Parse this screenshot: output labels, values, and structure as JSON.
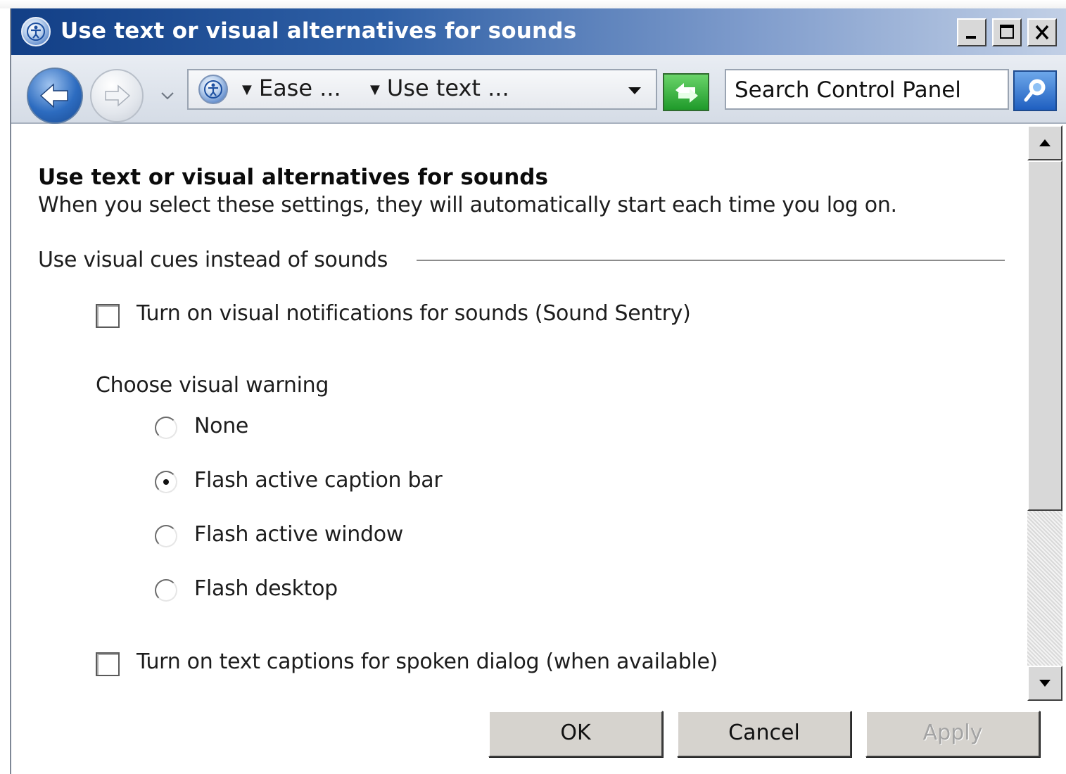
{
  "window": {
    "title": "Use text or visual alternatives for sounds"
  },
  "title_buttons": [
    "minimize",
    "maximize",
    "close"
  ],
  "address_bar": {
    "breadcrumbs": [
      {
        "label": "Ease ..."
      },
      {
        "label": "Use text ..."
      }
    ],
    "search": {
      "placeholder": "Search Control Panel",
      "value": ""
    }
  },
  "content": {
    "heading": "Use text or visual alternatives for sounds",
    "description": "When you select these settings, they will automatically start each time you log on.",
    "group_label": "Use visual cues instead of sounds",
    "sound_sentry": {
      "label": "Turn on visual notifications for sounds (Sound Sentry)",
      "checked": false
    },
    "choose_label": "Choose visual warning",
    "warnings": [
      {
        "label": "None",
        "selected": false
      },
      {
        "label": "Flash active caption bar",
        "selected": true
      },
      {
        "label": "Flash active window",
        "selected": false
      },
      {
        "label": "Flash desktop",
        "selected": false
      }
    ],
    "text_captions": {
      "label": "Turn on text captions for spoken dialog (when available)",
      "checked": false
    }
  },
  "buttons": {
    "ok": "OK",
    "cancel": "Cancel",
    "apply": "Apply"
  },
  "colors": {
    "title_bar_start": "#123f86",
    "title_bar_end": "#c2d0e6",
    "dialog_button": "#d6d3ce"
  }
}
